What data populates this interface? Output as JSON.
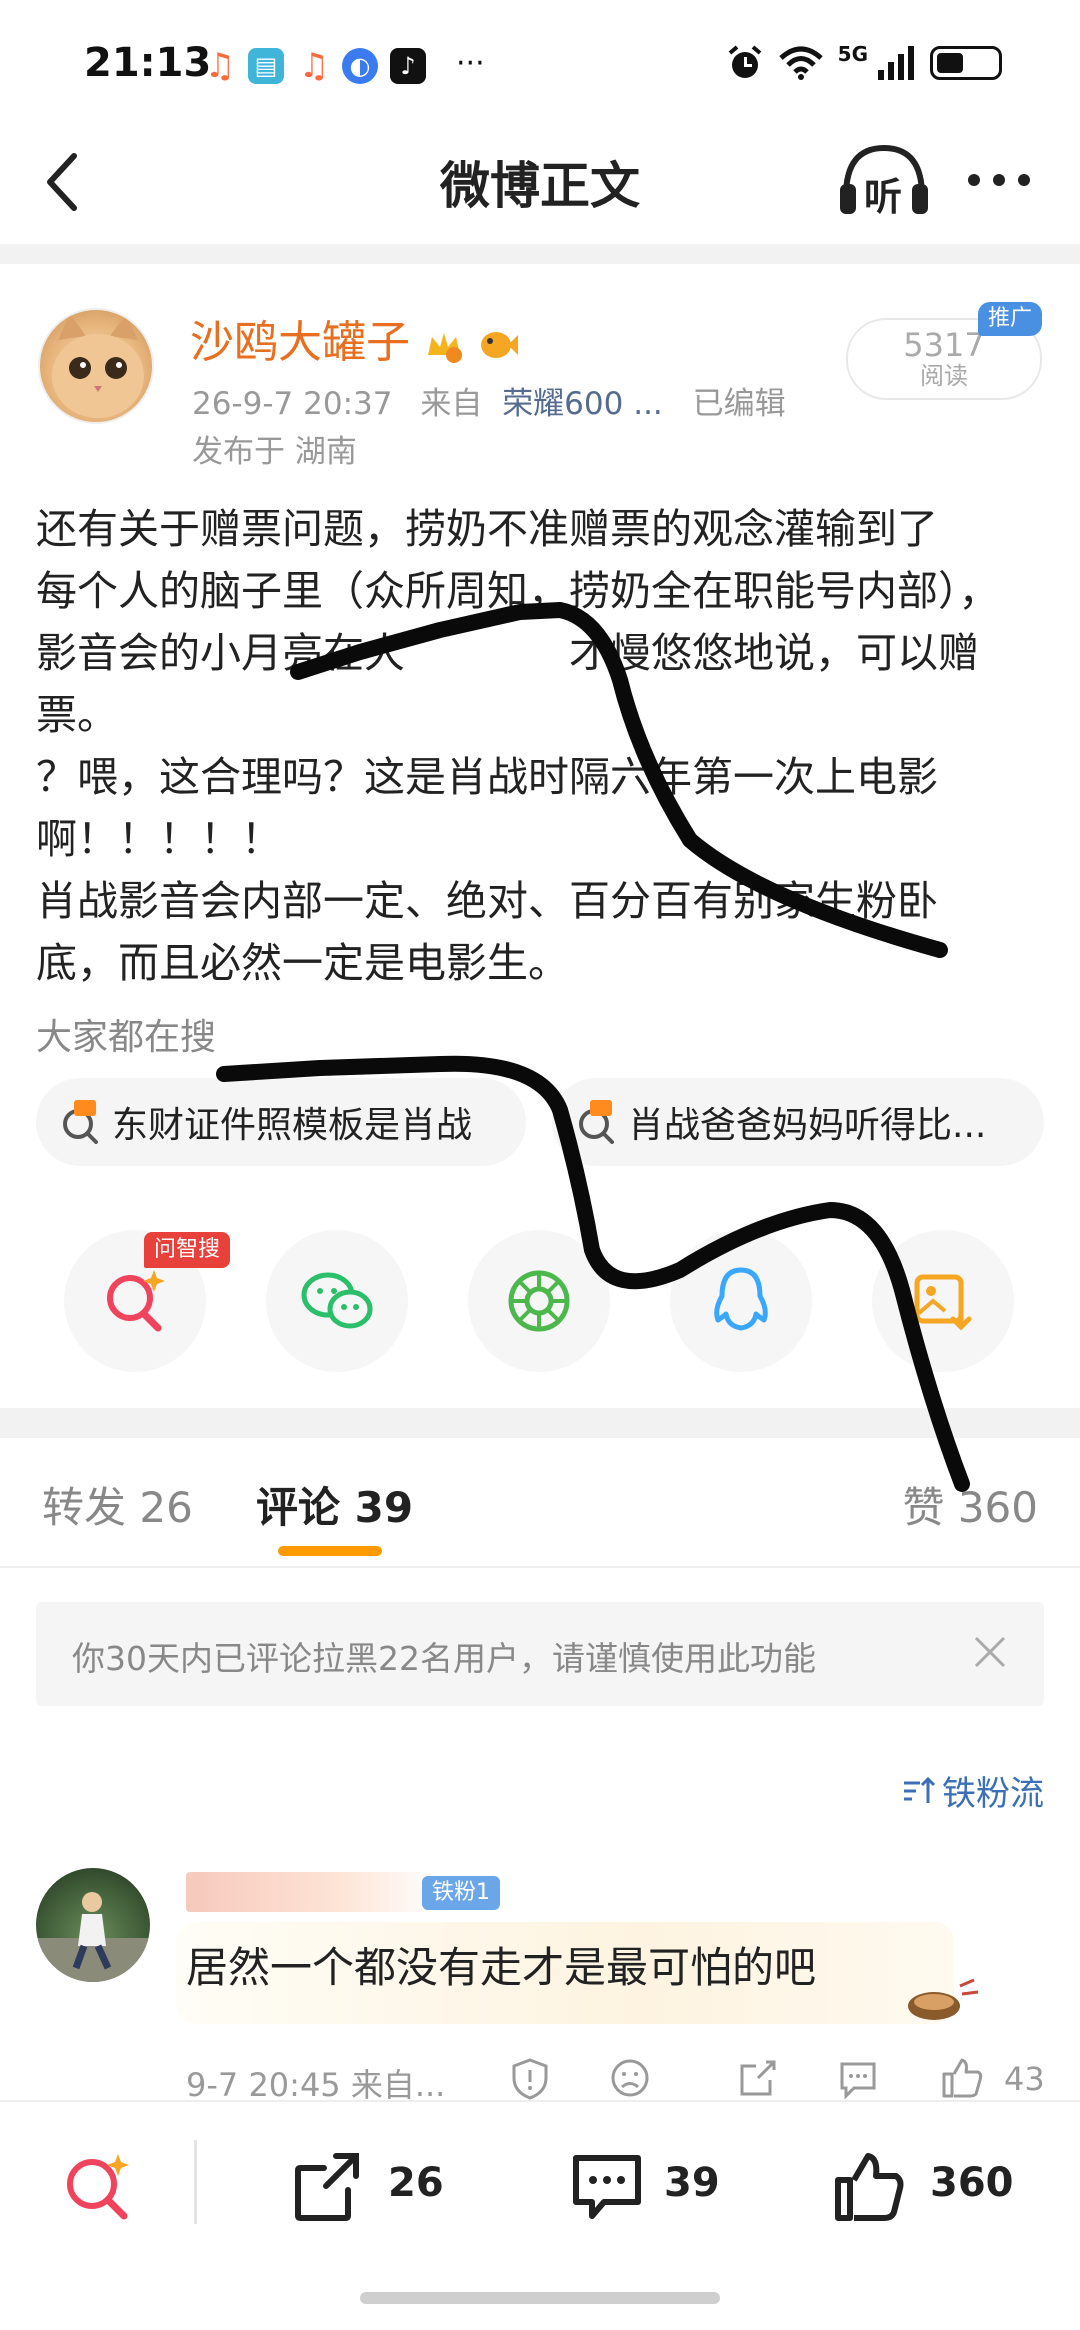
{
  "status_bar": {
    "time": "21:13",
    "more": "···",
    "network": "5G"
  },
  "nav": {
    "title": "微博正文",
    "listen_label": "听"
  },
  "post": {
    "author": "沙鸥大罐子",
    "timestamp": "26-9-7 20:37",
    "source_prefix": "来自",
    "source": "荣耀600 ...",
    "edited": "已编辑",
    "location": "发布于 湖南",
    "reads": "5317",
    "reads_label": "阅读",
    "promo": "推广",
    "body": "还有关于赠票问题，捞奶不准赠票的观念灌输到了\n每个人的脑子里（众所周知，捞奶全在职能号内部），\n影音会的小月亮在大　　　　才慢悠悠地说，可以赠\n票。\n？喂，这合理吗？这是肖战时隔六年第一次上电影\n啊！！！！！\n肖战影音会内部一定、绝对、百分百有别家生粉卧\n底，而且必然一定是电影生。"
  },
  "search": {
    "title": "大家都在搜",
    "chips": [
      {
        "label": "东财证件照模板是肖战"
      },
      {
        "label": "肖战爸爸妈妈听得比..."
      }
    ]
  },
  "share": {
    "ask_badge": "问智搜",
    "items": [
      "search-ai",
      "wechat",
      "moments",
      "qq",
      "save-image"
    ]
  },
  "tabs": {
    "repost": "转发 26",
    "comment": "评论 39",
    "like": "赞 360"
  },
  "notice": {
    "text": "你30天内已评论拉黑22名用户，请谨慎使用此功能"
  },
  "sort": {
    "label": "铁粉流"
  },
  "comment": {
    "badge": "铁粉1",
    "text": "居然一个都没有走才是最可怕的吧",
    "meta": "9-7 20:45  来自...",
    "likes": "43"
  },
  "bottom": {
    "repost": "26",
    "comment": "39",
    "like": "360"
  },
  "colors": {
    "accent": "#ff9a00",
    "author": "#e86f1f",
    "link": "#3c6fb5"
  }
}
